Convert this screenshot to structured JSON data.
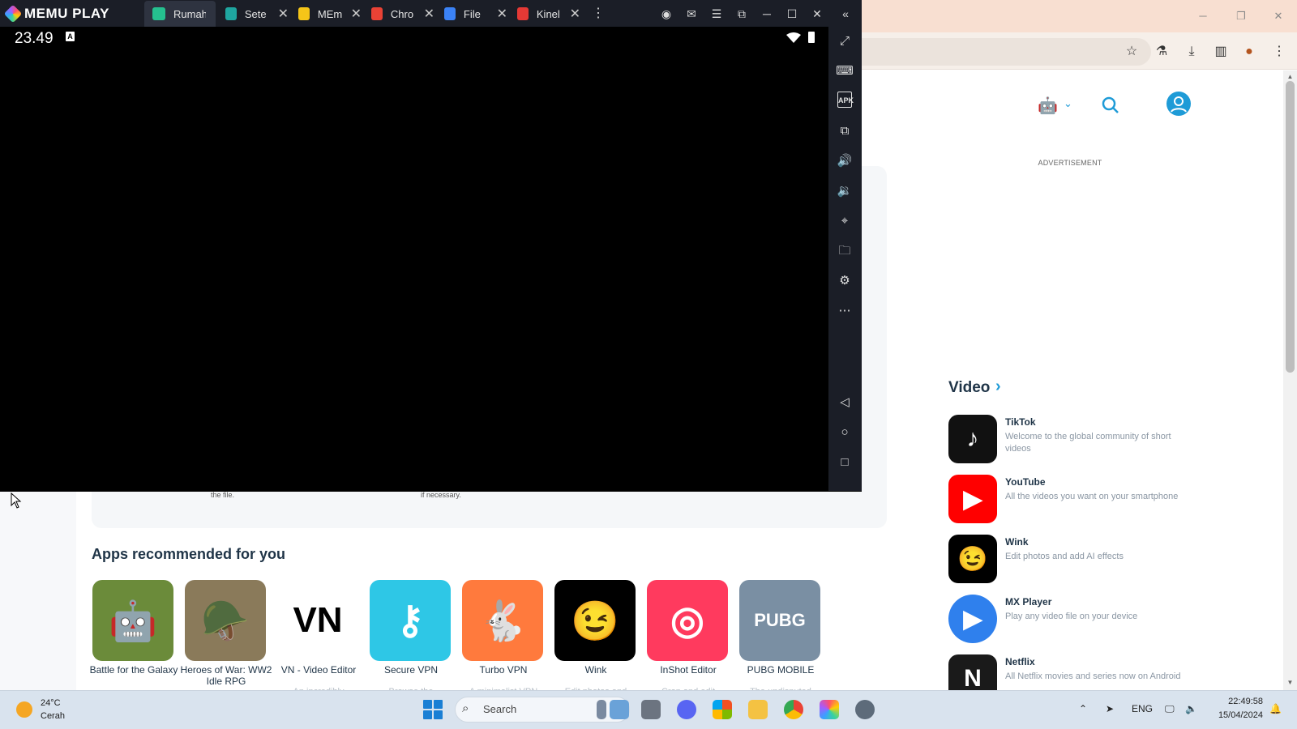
{
  "memu": {
    "brand": "MEMU PLAY",
    "tabs": [
      {
        "label": "Rumah",
        "color": "#25c08f"
      },
      {
        "label": "Sete",
        "color": "#1fa6a0"
      },
      {
        "label": "MEm",
        "color": "#f5c518"
      },
      {
        "label": "Chro",
        "color": "#e94235"
      },
      {
        "label": "File",
        "color": "#3b82f6"
      },
      {
        "label": "Kinel",
        "color": "#e53935"
      }
    ],
    "status_time": "23.49",
    "status_badge": "A",
    "sidebar_icons": [
      "fullscreen-icon",
      "keyboard-icon",
      "apk-icon",
      "multi-instance-icon",
      "volume-up-icon",
      "volume-down-icon",
      "location-icon",
      "folder-icon",
      "settings-icon",
      "more-icon",
      "back-icon",
      "home-icon",
      "recents-icon"
    ],
    "apk_label": "APK"
  },
  "website": {
    "advertisement_label": "ADVERTISEMENT",
    "video_section_title": "Video",
    "video_apps": [
      {
        "name": "TikTok",
        "desc": "Welcome to the global community of short videos",
        "color": "#111111",
        "glyph": "♪"
      },
      {
        "name": "YouTube",
        "desc": "All the videos you want on your smartphone",
        "color": "#ff0000",
        "glyph": "▶"
      },
      {
        "name": "Wink",
        "desc": "Edit photos and add AI effects",
        "color": "#000000",
        "glyph": "😉"
      },
      {
        "name": "MX Player",
        "desc": "Play any video file on your device",
        "color": "#2f80ed",
        "glyph": "▶"
      },
      {
        "name": "Netflix",
        "desc": "All Netflix movies and series now on Android",
        "color": "#1a1a1a",
        "glyph": "N"
      }
    ],
    "card_small_text_1": "the file.",
    "card_small_text_2": "if necessary.",
    "recommended_title": "Apps recommended for you",
    "recommended_apps": [
      {
        "name": "Battle for the Galaxy",
        "sub": "",
        "color": "#6b8b3a",
        "glyph": "🤖"
      },
      {
        "name": "Heroes of War: WW2 Idle RPG",
        "sub": "",
        "color": "#8a7a5a",
        "glyph": "🪖"
      },
      {
        "name": "VN - Video Editor",
        "sub": "An incredibly",
        "color": "#ffffff",
        "glyph": "VN"
      },
      {
        "name": "Secure VPN",
        "sub": "Browse the",
        "color": "#2ec7e6",
        "glyph": "⚷"
      },
      {
        "name": "Turbo VPN",
        "sub": "A minimalist VPN",
        "color": "#ff7a3d",
        "glyph": "🐇"
      },
      {
        "name": "Wink",
        "sub": "Edit photos and",
        "color": "#000000",
        "glyph": "😉"
      },
      {
        "name": "InShot Editor",
        "sub": "Crop and edit",
        "color": "#ff3a5e",
        "glyph": "◎"
      },
      {
        "name": "PUBG MOBILE",
        "sub": "The undisputed",
        "color": "#7a8fa3",
        "glyph": "PUBG"
      }
    ]
  },
  "taskbar": {
    "weather_temp": "24°C",
    "weather_desc": "Cerah",
    "search_label": "Search",
    "language": "ENG",
    "time": "22:49:58",
    "date": "15/04/2024"
  }
}
